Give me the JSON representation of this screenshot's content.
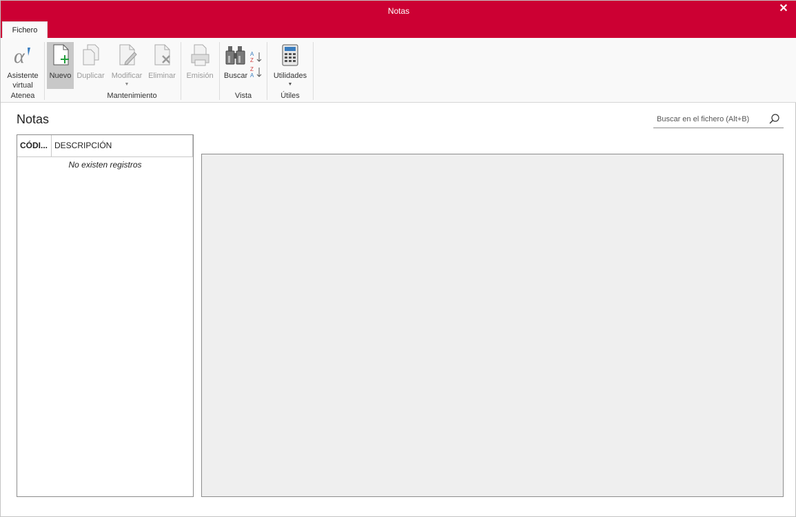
{
  "window": {
    "title": "Notas",
    "close_symbol": "✕"
  },
  "tabs": {
    "fichero": "Fichero"
  },
  "ribbon": {
    "atenea": {
      "label": "Atenea",
      "asistente": {
        "line1": "Asistente",
        "line2": "virtual"
      }
    },
    "mantenimiento": {
      "label": "Mantenimiento",
      "nuevo": "Nuevo",
      "duplicar": "Duplicar",
      "modificar": "Modificar",
      "eliminar": "Eliminar",
      "emision": "Emisión"
    },
    "vista": {
      "label": "Vista",
      "buscar": "Buscar"
    },
    "utiles": {
      "label": "Útiles",
      "utilidades": "Utilidades"
    }
  },
  "page": {
    "title": "Notas"
  },
  "search": {
    "placeholder": "Buscar en el fichero (Alt+B)"
  },
  "grid": {
    "columns": [
      "CÓDI...",
      "DESCRIPCIÓN"
    ],
    "empty_message": "No existen registros"
  },
  "colors": {
    "accent": "#cc0033",
    "panel": "#efefef",
    "ribbon": "#f9f9f9"
  },
  "icons": {
    "alpha": "alpha-icon",
    "new": "new-document-icon",
    "duplicate": "duplicate-icon",
    "modify": "edit-document-icon",
    "delete": "delete-document-icon",
    "print": "printer-icon",
    "search": "binoculars-icon",
    "sort_asc": "sort-ascending-icon",
    "sort_desc": "sort-descending-icon",
    "utilities": "calculator-icon",
    "find": "search-icon"
  }
}
